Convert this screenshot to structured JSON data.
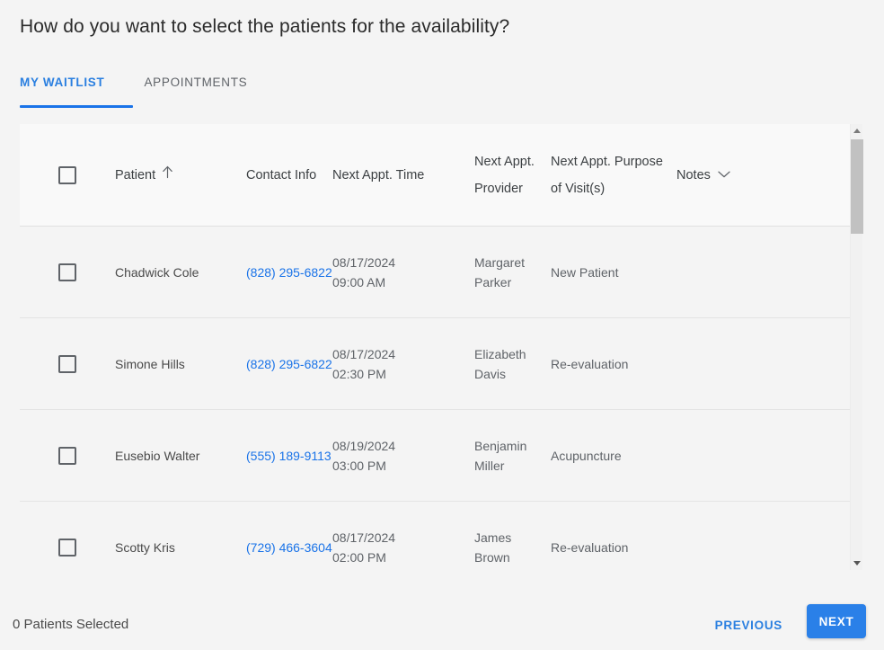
{
  "page_title": "How do you want to select the patients for the availability?",
  "tabs": [
    {
      "label": "MY WAITLIST",
      "active": true
    },
    {
      "label": "APPOINTMENTS",
      "active": false
    }
  ],
  "table": {
    "headers": {
      "select_all": "",
      "patient": "Patient",
      "contact_info": "Contact Info",
      "next_appt_time": "Next Appt. Time",
      "next_appt_provider": "Next Appt. Provider",
      "next_appt_purpose": "Next Appt. Purpose of Visit(s)",
      "notes": "Notes"
    },
    "sort": {
      "column": "Patient",
      "direction": "ascending",
      "icon": "arrow-up-icon"
    },
    "notes_icon": "chevron-down-icon",
    "rows": [
      {
        "patient": "Chadwick Cole",
        "phone": "(828) 295-6822",
        "appt_date": "08/17/2024",
        "appt_time": "09:00 AM",
        "provider_first": "Margaret",
        "provider_last": "Parker",
        "purpose": "New Patient",
        "notes": "",
        "checked": false
      },
      {
        "patient": "Simone Hills",
        "phone": "(828) 295-6822",
        "appt_date": "08/17/2024",
        "appt_time": "02:30 PM",
        "provider_first": "Elizabeth",
        "provider_last": "Davis",
        "purpose": "Re-evaluation",
        "notes": "",
        "checked": false
      },
      {
        "patient": "Eusebio Walter",
        "phone": "(555) 189-9113",
        "appt_date": "08/19/2024",
        "appt_time": "03:00 PM",
        "provider_first": "Benjamin",
        "provider_last": "Miller",
        "purpose": "Acupuncture",
        "notes": "",
        "checked": false
      },
      {
        "patient": "Scotty Kris",
        "phone": "(729) 466-3604",
        "appt_date": "08/17/2024",
        "appt_time": "02:00 PM",
        "provider_first": "James",
        "provider_last": "Brown",
        "purpose": "Re-evaluation",
        "notes": "",
        "checked": false
      }
    ]
  },
  "scrollbar": {
    "up_icon": "scroll-up-arrow-icon",
    "down_icon": "scroll-down-arrow-icon"
  },
  "footer": {
    "selection_count": "0 Patients Selected",
    "previous_label": "PREVIOUS",
    "next_label": "NEXT"
  },
  "colors": {
    "accent": "#1a73e8",
    "link": "#1a73e8",
    "page_bg": "#f4f4f4",
    "header_bg": "#f9f9f9",
    "next_button": "#2a80e8"
  }
}
